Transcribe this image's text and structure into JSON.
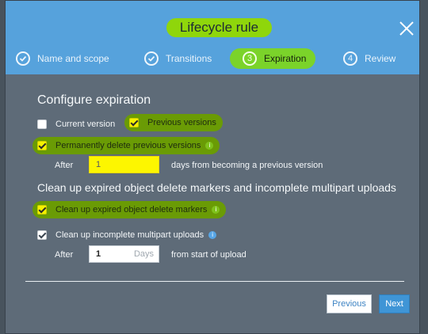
{
  "modal": {
    "title": "Lifecycle rule",
    "steps": [
      {
        "number": "",
        "label": "Name and scope",
        "state": "done"
      },
      {
        "number": "",
        "label": "Transitions",
        "state": "done"
      },
      {
        "number": "3",
        "label": "Expiration",
        "state": "active"
      },
      {
        "number": "4",
        "label": "Review",
        "state": "pending"
      }
    ]
  },
  "configure": {
    "heading": "Configure expiration",
    "current_version": {
      "label": "Current version",
      "checked": false
    },
    "previous_versions": {
      "label": "Previous versions",
      "checked": true
    },
    "permanently_delete": {
      "label": "Permanently delete previous versions",
      "checked": true
    },
    "after_label": "After",
    "days_value": "1",
    "days_suffix": "days from becoming a previous version"
  },
  "cleanup": {
    "heading": "Clean up expired object delete markers and incomplete multipart uploads",
    "expired_markers": {
      "label": "Clean up expired object delete markers",
      "checked": true
    },
    "incomplete_uploads": {
      "label": "Clean up incomplete multipart uploads",
      "checked": true
    },
    "after_label": "After",
    "upload_days_value": "1",
    "upload_days_unit": "Days",
    "upload_suffix": "from start of upload"
  },
  "footer": {
    "previous_label": "Previous",
    "next_label": "Next"
  },
  "colors": {
    "header": "#56a2dc",
    "highlight": "#7bd32a",
    "body": "#5e6b78",
    "primary_button": "#3f95d6"
  },
  "icons": {
    "close": "close-icon",
    "step_done": "check-circle-icon",
    "info": "info-icon"
  }
}
